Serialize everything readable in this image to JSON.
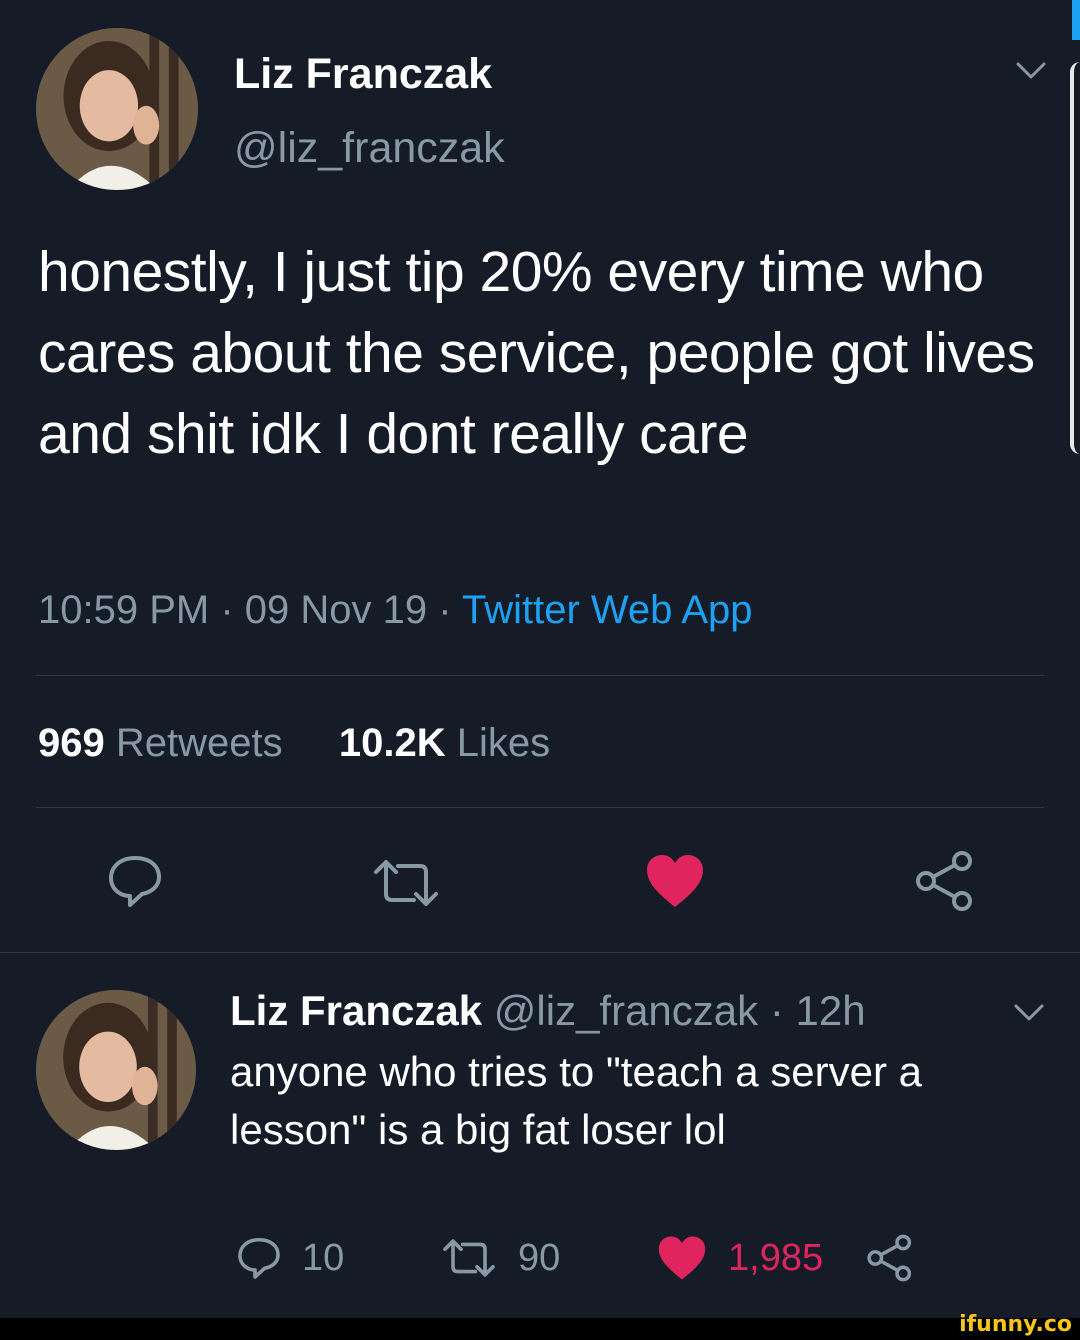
{
  "tweet": {
    "author_name": "Liz Franczak",
    "handle": "@liz_franczak",
    "text": "honestly, I just tip 20% every time who cares about the service, people got lives and shit idk I dont really care",
    "time": "10:59 PM",
    "date": "09 Nov 19",
    "separator": "·",
    "source": "Twitter Web App",
    "retweet_count": "969",
    "retweet_label": "Retweets",
    "like_count": "10.2K",
    "like_label": "Likes"
  },
  "reply": {
    "author_name": "Liz Franczak",
    "handle": "@liz_franczak",
    "age": "· 12h",
    "text": "anyone who tries to \"teach a server a lesson\" is a big fat loser lol",
    "reply_count": "10",
    "retweet_count": "90",
    "like_count": "1,985"
  },
  "watermark": "ifunny.co",
  "colors": {
    "background": "#151c27",
    "muted": "#8899a6",
    "link": "#1da1f2",
    "like": "#e0245e"
  },
  "icons": [
    "chevron-down-icon",
    "reply-icon",
    "retweet-icon",
    "heart-icon",
    "share-icon"
  ]
}
